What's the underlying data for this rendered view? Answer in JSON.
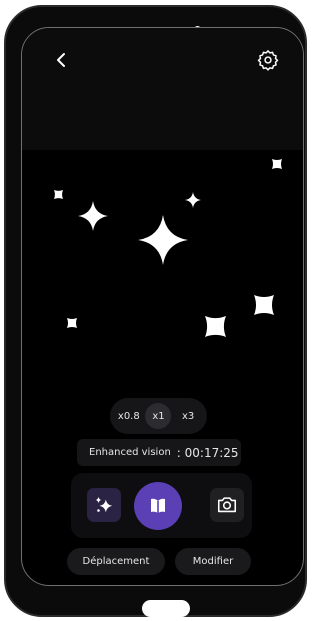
{
  "header": {
    "back_icon": "chevron-left-icon",
    "settings_icon": "gear-icon"
  },
  "zoom": {
    "options": [
      "x0.8",
      "x1",
      "x3"
    ],
    "selected": "x1"
  },
  "status": {
    "mode": "Enhanced vision",
    "timer": ": 00:17:25"
  },
  "controls": {
    "left_icon": "sparkle-icon",
    "center_icon": "book-icon",
    "right_icon": "camera-icon",
    "accent_color": "#5b3fb5"
  },
  "actions": {
    "deplacement_label": "Déplacement",
    "modifier_label": "Modifier"
  }
}
